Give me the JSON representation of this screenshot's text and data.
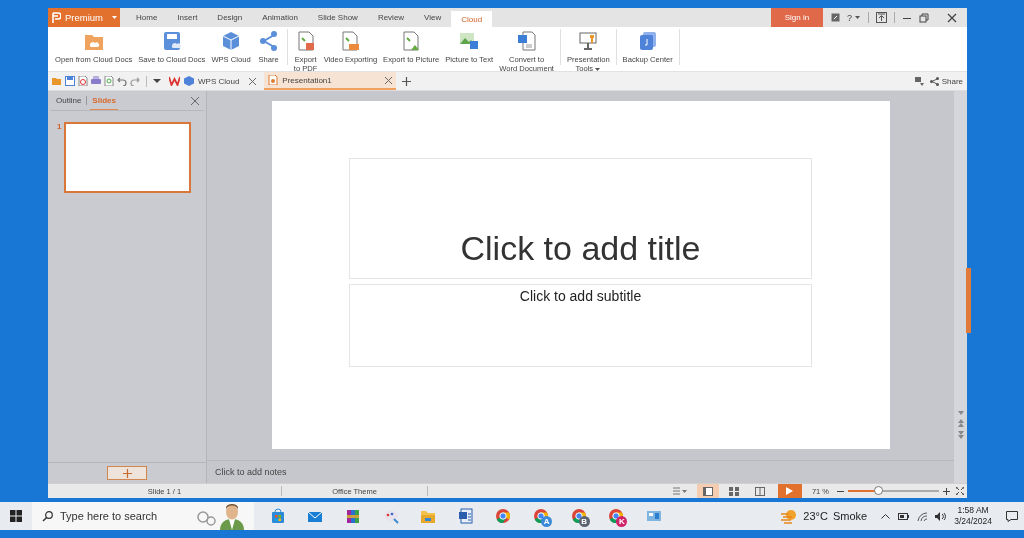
{
  "app": {
    "brand": "Premium",
    "menu_tabs": [
      {
        "label": "Home",
        "selected": false
      },
      {
        "label": "Insert",
        "selected": false
      },
      {
        "label": "Design",
        "selected": false
      },
      {
        "label": "Animation",
        "selected": false
      },
      {
        "label": "Slide Show",
        "selected": false
      },
      {
        "label": "Review",
        "selected": false
      },
      {
        "label": "View",
        "selected": false
      },
      {
        "label": "Cloud",
        "selected": true
      }
    ],
    "sign_in": "Sign in",
    "help": "?"
  },
  "ribbon": {
    "groups": [
      {
        "buttons": [
          {
            "label": "Open from Cloud Docs",
            "kind": "cloud-folder"
          },
          {
            "label": "Save to Cloud Docs",
            "kind": "cloud-save"
          },
          {
            "label": "WPS Cloud",
            "kind": "cube"
          },
          {
            "label": "Share",
            "kind": "share"
          }
        ]
      },
      {
        "buttons": [
          {
            "label": "Export\nto PDF",
            "kind": "pdf"
          },
          {
            "label": "Video Exporting",
            "kind": "video"
          },
          {
            "label": "Export to Picture",
            "kind": "picture-export"
          },
          {
            "label": "Picture to Text",
            "kind": "picture-text"
          },
          {
            "label": "Convert to\nWord Document",
            "kind": "convert"
          }
        ]
      },
      {
        "buttons": [
          {
            "label": "Presentation\nTools",
            "kind": "tools"
          }
        ]
      },
      {
        "buttons": [
          {
            "label": "Backup Center",
            "kind": "backup"
          }
        ]
      }
    ]
  },
  "docbar": {
    "tabs": [
      {
        "label": "WPS Cloud",
        "kind": "cloud",
        "selected": false
      },
      {
        "label": "Presentation1",
        "kind": "presentation",
        "selected": true
      }
    ],
    "share": "Share"
  },
  "panel": {
    "tabs": [
      {
        "label": "Outline",
        "selected": false
      },
      {
        "label": "Slides",
        "selected": true
      }
    ],
    "slides": [
      {
        "number": "1",
        "selected": true
      }
    ]
  },
  "slide": {
    "title_placeholder": "Click to add title",
    "subtitle_placeholder": "Click to add subtitle"
  },
  "notes": {
    "placeholder": "Click to add notes"
  },
  "status_bar": {
    "slide": "Slide 1 / 1",
    "theme": "Office Theme",
    "views": [
      {
        "kind": "normal",
        "selected": true
      },
      {
        "kind": "sorter",
        "selected": false
      },
      {
        "kind": "reading",
        "selected": false
      }
    ],
    "zoom": {
      "reading": "71 %",
      "level": 0.34
    }
  },
  "taskbar": {
    "search_placeholder": "Type here to search",
    "apps": [
      {
        "kind": "store"
      },
      {
        "kind": "mail"
      },
      {
        "kind": "archive"
      },
      {
        "kind": "paint"
      },
      {
        "kind": "folder"
      },
      {
        "kind": "word"
      },
      {
        "kind": "chrome"
      },
      {
        "kind": "chrome",
        "badge": "A",
        "color": "#3b8ad9"
      },
      {
        "kind": "chrome",
        "badge": "B",
        "color": "#5a6470"
      },
      {
        "kind": "chrome",
        "badge": "K",
        "color": "#d0246a"
      },
      {
        "kind": "window"
      }
    ],
    "weather": {
      "temperature": "23°C",
      "condition": "Smoke"
    },
    "time": "1:58 AM",
    "date": "3/24/2024"
  }
}
